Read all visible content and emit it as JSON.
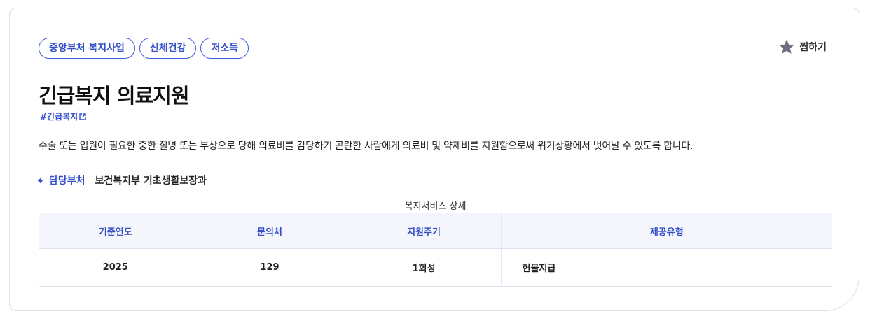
{
  "tags": [
    "중앙부처 복지사업",
    "신체건강",
    "저소득"
  ],
  "favorite": {
    "label": "찜하기"
  },
  "title": "긴급복지 의료지원",
  "hashtag": "#긴급복지",
  "description": "수술 또는 입원이 필요한 중한 질병 또는 부상으로 당해 의료비를 감당하기 곤란한 사람에게 의료비 및 약제비를 지원함으로써 위기상황에서 벗어날 수 있도록 합니다.",
  "department": {
    "label": "담당부처",
    "value": "보건복지부 기초생활보장과"
  },
  "detail_table": {
    "caption": "복지서비스 상세",
    "headers": [
      "기준연도",
      "문의처",
      "지원주기",
      "제공유형"
    ],
    "row": [
      "2025",
      "129",
      "1회성",
      "현물지급"
    ]
  },
  "colors": {
    "accent": "#3550c8",
    "header_bg": "#f4f6fb",
    "star": "#6b6f80"
  },
  "icons": {
    "favorite": "star-icon",
    "link": "external-link-icon"
  }
}
